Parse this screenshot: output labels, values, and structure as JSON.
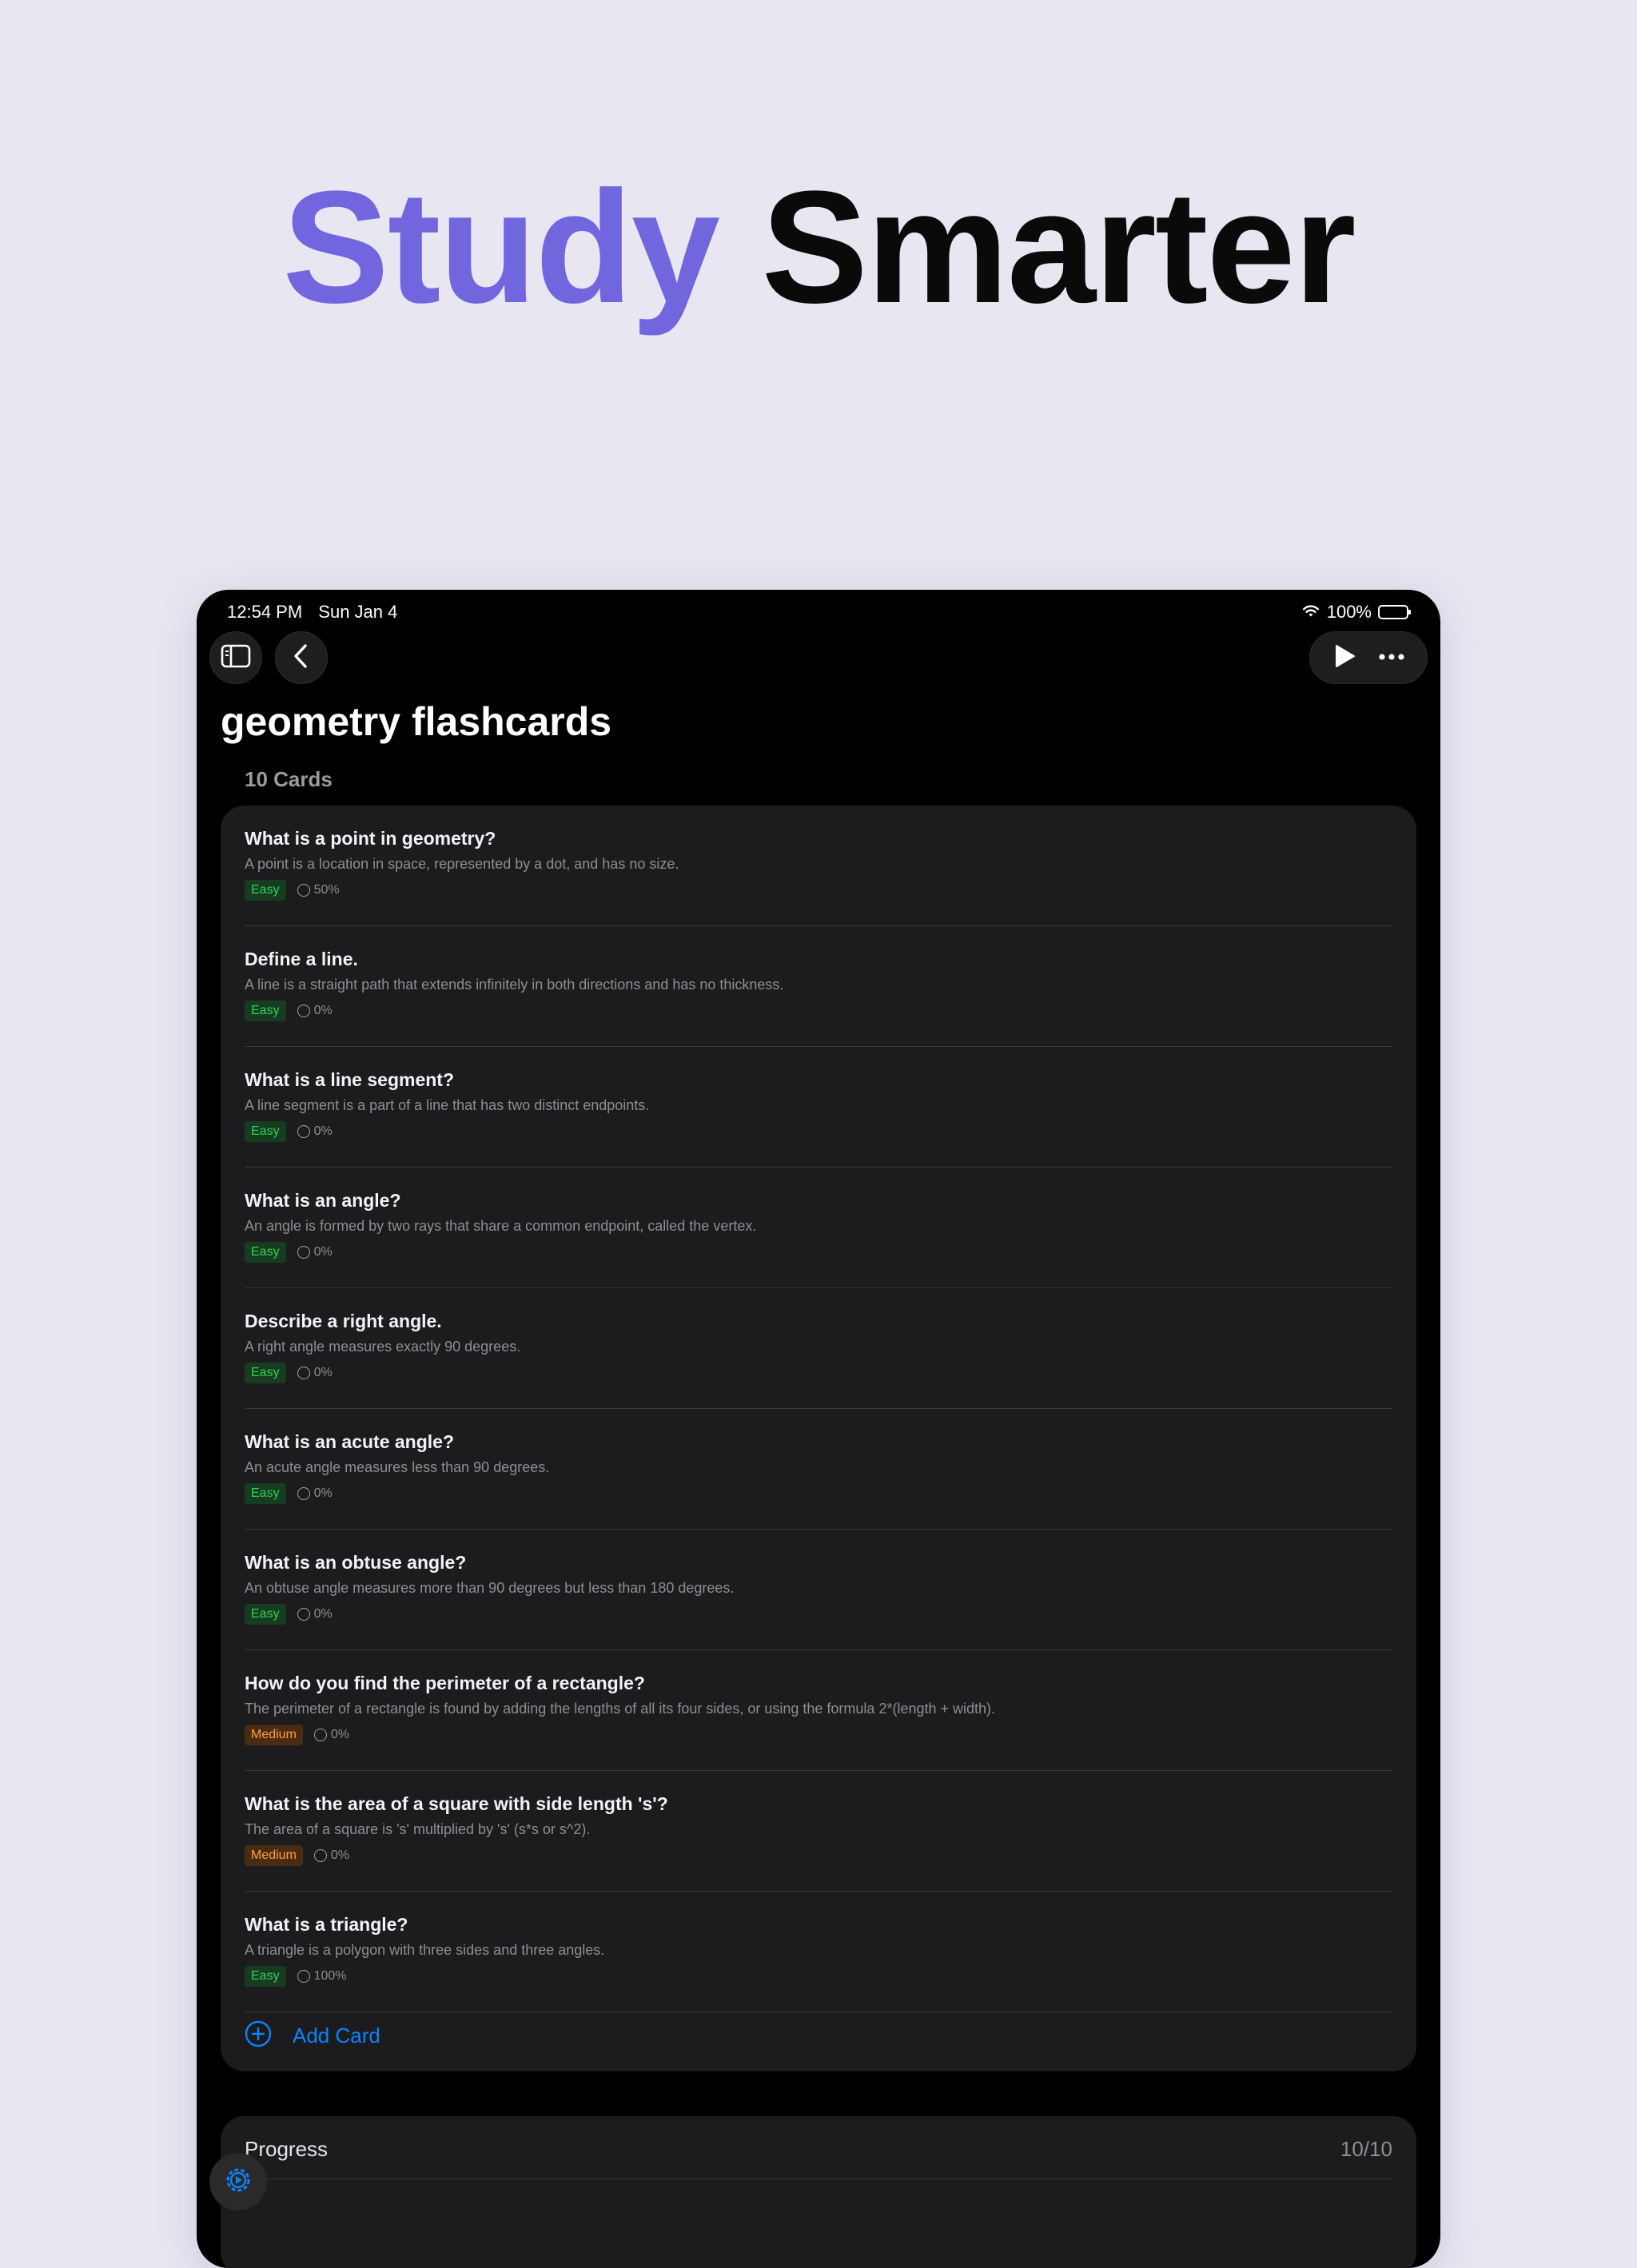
{
  "headline": {
    "word1": "Study",
    "word2": "Smarter"
  },
  "status_bar": {
    "time": "12:54 PM",
    "date": "Sun Jan 4",
    "battery": "100%"
  },
  "deck": {
    "title": "geometry flashcards",
    "count": "10 Cards"
  },
  "cards": [
    {
      "question": "What is a point in geometry?",
      "answer": "A point is a location in space, represented by a dot, and has no size.",
      "difficulty": "Easy",
      "progress": "50%"
    },
    {
      "question": "Define a line.",
      "answer": "A line is a straight path that extends infinitely in both directions and has no thickness.",
      "difficulty": "Easy",
      "progress": "0%"
    },
    {
      "question": "What is a line segment?",
      "answer": "A line segment is a part of a line that has two distinct endpoints.",
      "difficulty": "Easy",
      "progress": "0%"
    },
    {
      "question": "What is an angle?",
      "answer": "An angle is formed by two rays that share a common endpoint, called the vertex.",
      "difficulty": "Easy",
      "progress": "0%"
    },
    {
      "question": "Describe a right angle.",
      "answer": "A right angle measures exactly 90 degrees.",
      "difficulty": "Easy",
      "progress": "0%"
    },
    {
      "question": "What is an acute angle?",
      "answer": "An acute angle measures less than 90 degrees.",
      "difficulty": "Easy",
      "progress": "0%"
    },
    {
      "question": "What is an obtuse angle?",
      "answer": "An obtuse angle measures more than 90 degrees but less than 180 degrees.",
      "difficulty": "Easy",
      "progress": "0%"
    },
    {
      "question": "How do you find the perimeter of a rectangle?",
      "answer": "The perimeter of a rectangle is found by adding the lengths of all its four sides, or using the formula 2*(length + width).",
      "difficulty": "Medium",
      "progress": "0%"
    },
    {
      "question": "What is the area of a square with side length 's'?",
      "answer": "The area of a square is 's' multiplied by 's' (s*s or s^2).",
      "difficulty": "Medium",
      "progress": "0%"
    },
    {
      "question": "What is a triangle?",
      "answer": "A triangle is a polygon with three sides and three angles.",
      "difficulty": "Easy",
      "progress": "100%"
    }
  ],
  "add_card": {
    "label": "Add Card"
  },
  "progress_section": {
    "label": "Progress",
    "value": "10/10"
  },
  "icons": {
    "sidebar": "sidebar-icon",
    "back": "chevron-left-icon",
    "play": "play-icon",
    "more": "ellipsis-icon",
    "add": "plus-circle-icon",
    "fab": "gear-icon",
    "wifi": "wifi-icon",
    "battery": "battery-icon"
  },
  "colors": {
    "accent_purple": "#7166dd",
    "link_blue": "#0a84ff",
    "easy_green": "#30d158",
    "medium_orange": "#ff9f3a",
    "panel": "#1c1c1e",
    "background": "#e8e6f1"
  }
}
